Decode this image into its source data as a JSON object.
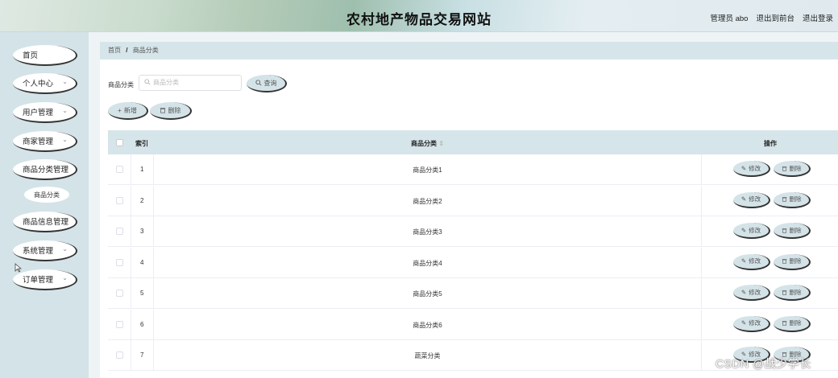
{
  "header": {
    "title": "农村地产物品交易网站",
    "admin": "管理员 abo",
    "to_front": "退出到前台",
    "logout": "退出登录"
  },
  "sidebar": {
    "items": [
      {
        "label": "首页",
        "has_chevron": false
      },
      {
        "label": "个人中心",
        "has_chevron": true
      },
      {
        "label": "用户管理",
        "has_chevron": true
      },
      {
        "label": "商家管理",
        "has_chevron": true
      },
      {
        "label": "商品分类管理",
        "has_chevron": false
      },
      {
        "label": "商品信息管理",
        "has_chevron": false
      },
      {
        "label": "系统管理",
        "has_chevron": true
      },
      {
        "label": "订单管理",
        "has_chevron": true
      }
    ],
    "sub_item": "商品分类",
    "chevron": "⌄"
  },
  "breadcrumb": {
    "home": "首页",
    "sep": "/",
    "current": "商品分类"
  },
  "search": {
    "label": "商品分类",
    "placeholder": "商品分类",
    "button": "查询",
    "search_icon": "search-icon"
  },
  "actions": {
    "add": "新增",
    "delete": "删除"
  },
  "table": {
    "headers": {
      "index": "索引",
      "name": "商品分类",
      "sort_glyph": "⇕",
      "operations": "操作"
    },
    "edit_label": "修改",
    "delete_label": "删除",
    "rows": [
      {
        "index": "1",
        "name": "商品分类1"
      },
      {
        "index": "2",
        "name": "商品分类2"
      },
      {
        "index": "3",
        "name": "商品分类3"
      },
      {
        "index": "4",
        "name": "商品分类4"
      },
      {
        "index": "5",
        "name": "商品分类5"
      },
      {
        "index": "6",
        "name": "商品分类6"
      },
      {
        "index": "7",
        "name": "蔬菜分类"
      }
    ]
  },
  "watermark": "CSDN @战少学长",
  "colors": {
    "sidebar_bg": "#d4e3e8",
    "table_header_bg": "#d6e5ea",
    "pill_bg": "#d4e3e8"
  }
}
